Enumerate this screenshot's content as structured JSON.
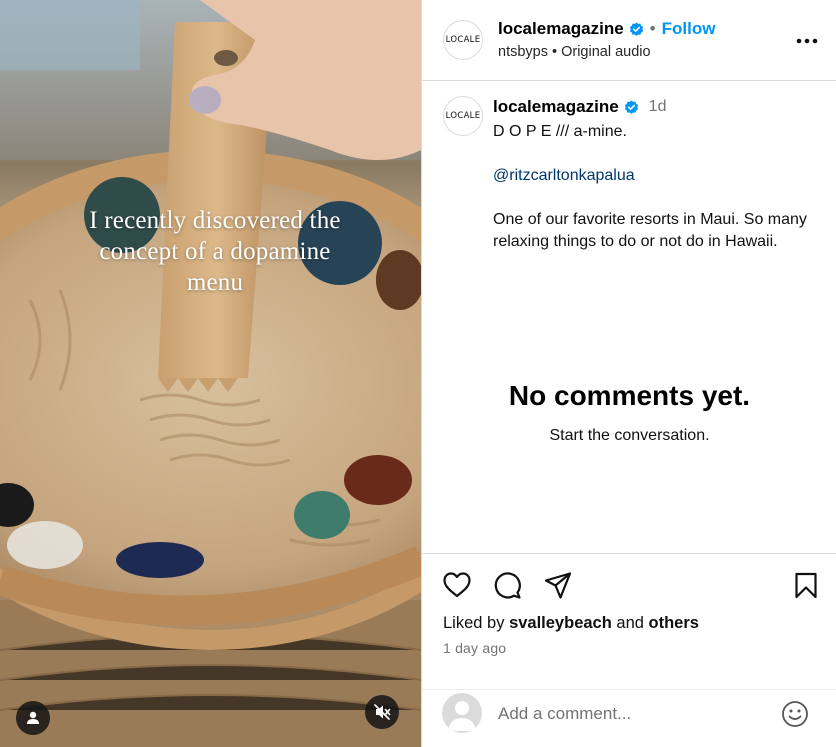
{
  "media": {
    "overlay_lines": [
      "I recently discovered the",
      "concept of a dopamine",
      "menu"
    ],
    "user_tag_icon": "user-icon",
    "mute_icon": "speaker-muted-icon"
  },
  "header": {
    "avatar_text": "LOCALE",
    "username": "localemagazine",
    "separator": "•",
    "follow_label": "Follow",
    "subtitle": "ntsbyps • Original audio",
    "more_icon": "more-options-icon"
  },
  "caption": {
    "avatar_text": "LOCALE",
    "username": "localemagazine",
    "time": "1d",
    "line1": "D O P E /// a-mine.",
    "mention": "@ritzcarltonkapalua",
    "body": "One of our favorite resorts in Maui. So many relaxing things to do or not do in Hawaii."
  },
  "comments": {
    "empty_title": "No comments yet.",
    "empty_subtitle": "Start the conversation."
  },
  "actions": {
    "liked_prefix": "Liked by",
    "liked_user": "svalleybeach",
    "liked_and": "and",
    "liked_others": "others",
    "time_ago": "1 day ago"
  },
  "add_comment": {
    "placeholder": "Add a comment...",
    "emoji_icon": "emoji-icon"
  },
  "colors": {
    "link": "#0095f6",
    "verified": "#0095f6",
    "mention": "#00376b",
    "secondary_text": "#737373",
    "border": "#dbdbdb"
  }
}
